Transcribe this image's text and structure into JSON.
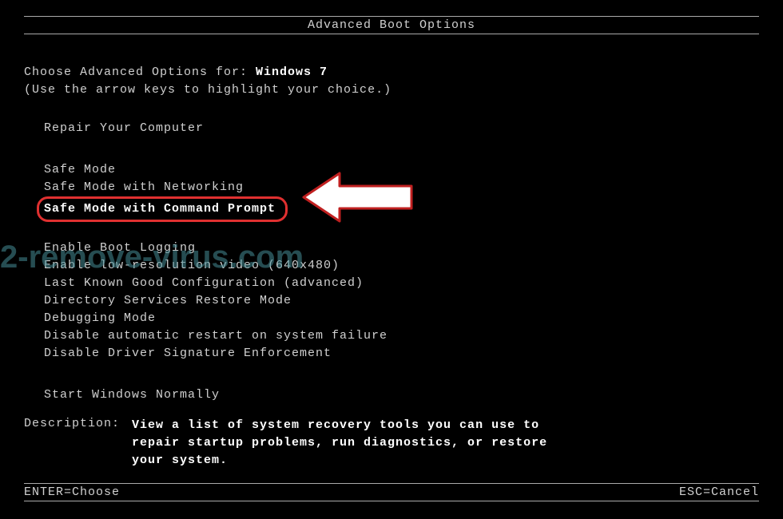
{
  "title": "Advanced Boot Options",
  "choose_prefix": "Choose Advanced Options for: ",
  "os_name": "Windows 7",
  "hint": "(Use the arrow keys to highlight your choice.)",
  "menu": {
    "repair": "Repair Your Computer",
    "safe_mode": "Safe Mode",
    "safe_mode_net": "Safe Mode with Networking",
    "safe_mode_cmd": "Safe Mode with Command Prompt",
    "boot_logging": "Enable Boot Logging",
    "low_res": "Enable low-resolution video (640x480)",
    "last_known": "Last Known Good Configuration (advanced)",
    "dsrm": "Directory Services Restore Mode",
    "debugging": "Debugging Mode",
    "disable_restart": "Disable automatic restart on system failure",
    "disable_driver_sig": "Disable Driver Signature Enforcement",
    "start_normally": "Start Windows Normally"
  },
  "description_label": "Description:",
  "description_text": "View a list of system recovery tools you can use to repair startup problems, run diagnostics, or restore your system.",
  "footer": {
    "enter": "ENTER=Choose",
    "esc": "ESC=Cancel"
  },
  "watermark": "2-remove-virus.com",
  "annotation": {
    "highlight_color": "#e03030",
    "arrow_fill": "#ffffff"
  }
}
